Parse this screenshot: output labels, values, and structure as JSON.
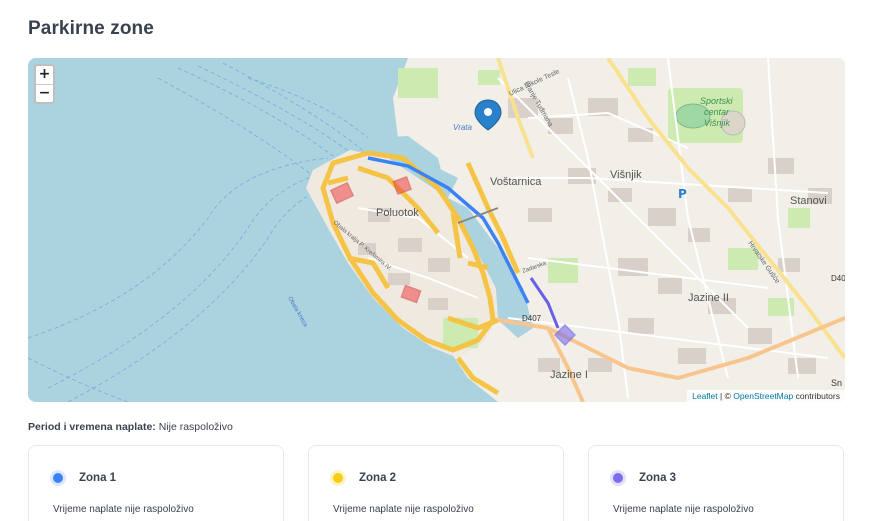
{
  "page": {
    "title": "Parkirne zone"
  },
  "map": {
    "zoom_in": "+",
    "zoom_out": "−",
    "labels": {
      "poluotok": "Poluotok",
      "vostarnica": "Voštarnica",
      "visnjik": "Višnjik",
      "stanovi": "Stanovi",
      "jazine2": "Jazine II",
      "jazine1": "Jazine I",
      "sportski1": "Sportski",
      "sportski2": "centar",
      "sportski3": "Višnjik",
      "parking": "P",
      "road_d407": "D407",
      "road_d40": "D40",
      "ulica_nikole": "Ulica Nikole Tesle",
      "franje": "Franje Tuđmana",
      "vrata": "Vrata",
      "obala": "Obala kralja P. Krešimira IV.",
      "hrvatska": "Hrvatske Gušće",
      "ul_zadarska": "Zadarska",
      "kneza": "Obala kneza",
      "sn": "Sn"
    },
    "attribution": {
      "leaflet": "Leaflet",
      "sep": " | © ",
      "osm": "OpenStreetMap",
      "tail": " contributors"
    },
    "colors": {
      "water": "#aad3df",
      "land": "#f2efe9",
      "zone1": "#3b82f6",
      "zone2": "#facc15",
      "zone3": "#7c6cf0",
      "red_zone": "#ef4444",
      "marker": "#2a81cb"
    }
  },
  "period": {
    "label": "Period i vremena naplate:",
    "value": " Nije raspoloživo"
  },
  "zones": [
    {
      "name": "Zona 1",
      "color": "#3b82f6",
      "text": "Vrijeme naplate nije raspoloživo"
    },
    {
      "name": "Zona 2",
      "color": "#facc15",
      "text": "Vrijeme naplate nije raspoloživo"
    },
    {
      "name": "Zona 3",
      "color": "#7c6cf0",
      "text": "Vrijeme naplate nije raspoloživo"
    }
  ]
}
